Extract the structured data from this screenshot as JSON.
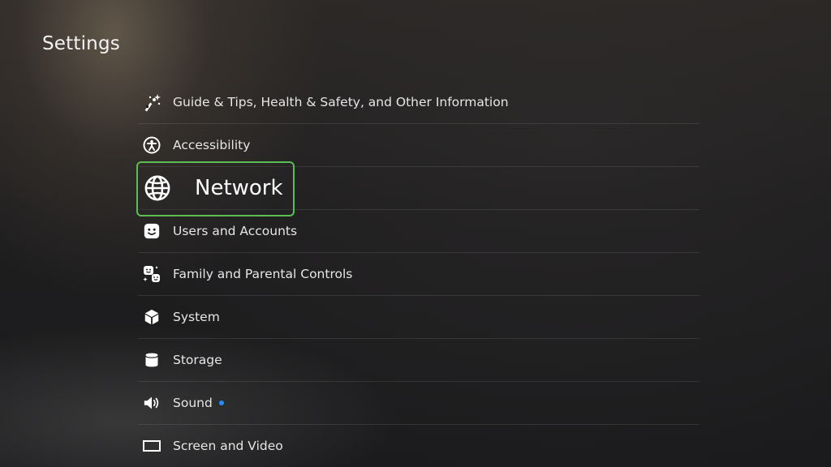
{
  "page": {
    "title": "Settings"
  },
  "menu": {
    "items": [
      {
        "label": "Guide & Tips, Health & Safety, and Other Information",
        "icon": "guide-tips-icon"
      },
      {
        "label": "Accessibility",
        "icon": "accessibility-icon"
      },
      {
        "label": "Network",
        "icon": "globe-icon",
        "selected": true
      },
      {
        "label": "Users and Accounts",
        "icon": "user-face-icon"
      },
      {
        "label": "Family and Parental Controls",
        "icon": "family-icon"
      },
      {
        "label": "System",
        "icon": "cube-icon"
      },
      {
        "label": "Storage",
        "icon": "storage-cylinder-icon"
      },
      {
        "label": "Sound",
        "icon": "speaker-icon",
        "notification_dot": true
      },
      {
        "label": "Screen and Video",
        "icon": "screen-icon"
      }
    ]
  },
  "colors": {
    "focus_border": "#5dbd55",
    "notification_dot": "#1f8fff",
    "text": "#e6e6e6"
  }
}
